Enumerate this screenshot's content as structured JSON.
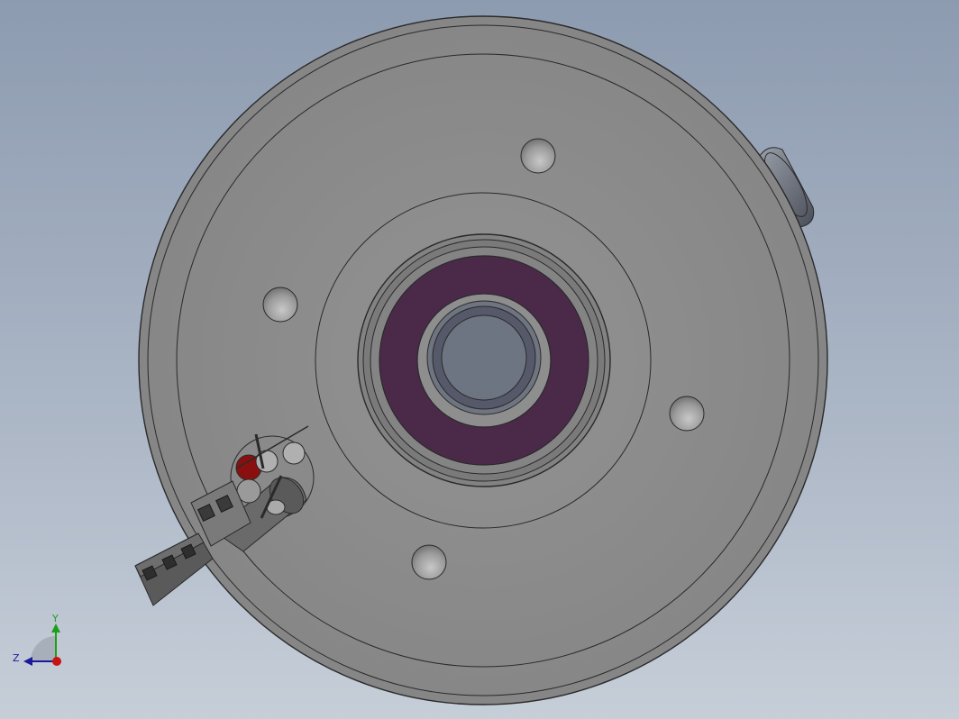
{
  "viewport": {
    "background_top": "#8d9bb0",
    "background_bottom": "#c6ced8"
  },
  "part": {
    "body_color": "#8e8e8e",
    "edge_color": "#2a2a2a",
    "seal_color": "#4a2a48",
    "bore_color": "#6d7482",
    "contact_color": "#8a1010"
  },
  "triad": {
    "x_label": "",
    "y_label": "Y",
    "z_label": "Z",
    "y_color": "#1aa01a",
    "z_color": "#1a1aaa",
    "x_color": "#cc1111"
  }
}
